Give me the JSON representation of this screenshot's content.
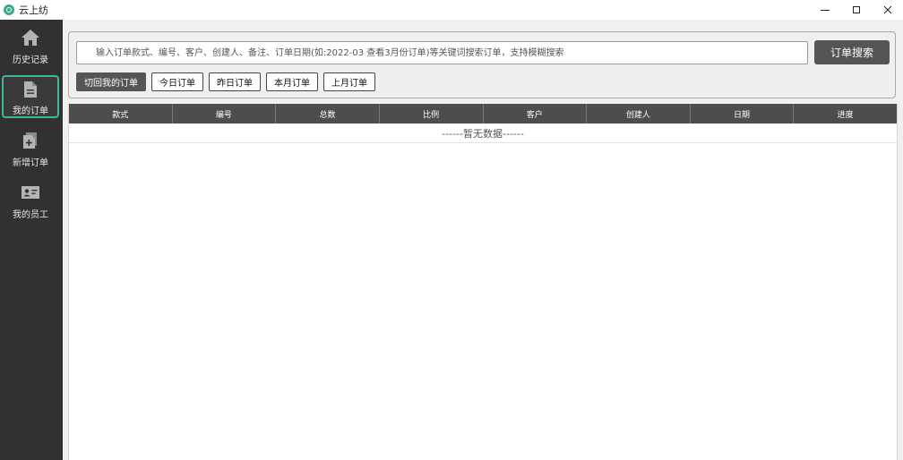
{
  "window": {
    "title": "云上纺"
  },
  "sidebar": {
    "items": [
      {
        "label": "历史记录",
        "icon": "home-icon",
        "active": false
      },
      {
        "label": "我的订单",
        "icon": "document-icon",
        "active": true
      },
      {
        "label": "新增订单",
        "icon": "add-document-icon",
        "active": false
      },
      {
        "label": "我的员工",
        "icon": "id-card-icon",
        "active": false
      }
    ]
  },
  "search": {
    "placeholder": "输入订单款式、编号、客户、创建人、备注、订单日期(如:2022-03 查看3月份订单)等关键词搜索订单，支持模糊搜索",
    "value": "",
    "button_label": "订单搜索"
  },
  "filters": {
    "switch_mine": "切回我的订单",
    "today": "今日订单",
    "yesterday": "昨日订单",
    "this_month": "本月订单",
    "last_month": "上月订单"
  },
  "table": {
    "columns": [
      "款式",
      "编号",
      "总数",
      "比例",
      "客户",
      "创建人",
      "日期",
      "进度"
    ],
    "empty_text": "------暂无数据------"
  },
  "colors": {
    "sidebar_bg": "#313131",
    "accent": "#3bb89e",
    "button_dark": "#555555",
    "header_bg": "#4d4d4d"
  }
}
